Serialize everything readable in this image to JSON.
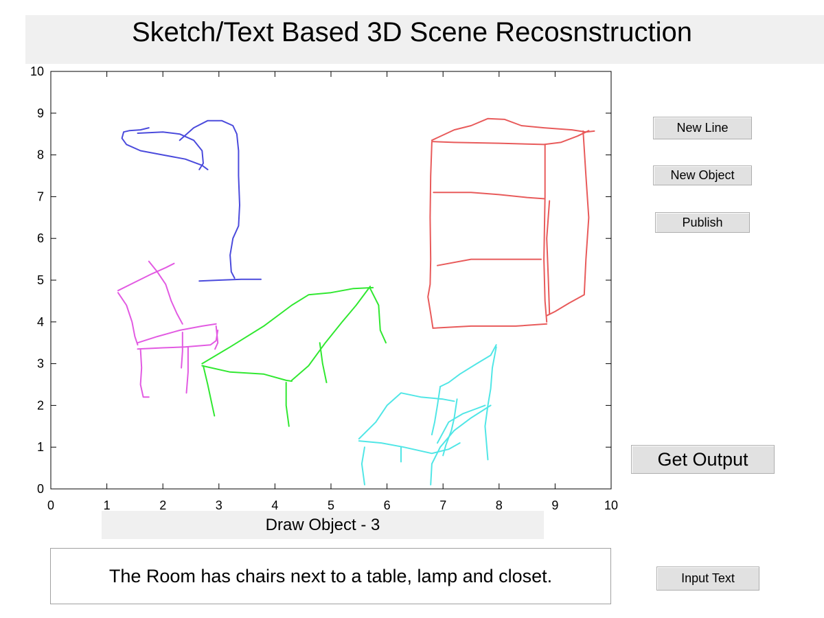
{
  "title": "Sketch/Text Based 3D Scene Recosnstruction",
  "buttons": {
    "new_line": "New Line",
    "new_object": "New Object",
    "publish": "Publish",
    "get_output": "Get Output",
    "input_text": "Input Text"
  },
  "status": "Draw Object - 3",
  "text_input": "The Room has chairs next to a table, lamp and closet.",
  "plot": {
    "xlim": [
      0,
      10
    ],
    "ylim": [
      0,
      10
    ],
    "xticks": [
      0,
      1,
      2,
      3,
      4,
      5,
      6,
      7,
      8,
      9,
      10
    ],
    "yticks": [
      0,
      1,
      2,
      3,
      4,
      5,
      6,
      7,
      8,
      9,
      10
    ],
    "sketches": [
      {
        "name": "lamp",
        "color": "#4a4adc",
        "strokes": [
          [
            [
              1.75,
              8.65
            ],
            [
              1.6,
              8.6
            ],
            [
              1.4,
              8.58
            ],
            [
              1.3,
              8.55
            ],
            [
              1.27,
              8.4
            ],
            [
              1.35,
              8.25
            ],
            [
              1.6,
              8.1
            ],
            [
              2.0,
              8.0
            ],
            [
              2.4,
              7.9
            ],
            [
              2.7,
              7.75
            ],
            [
              2.8,
              7.65
            ]
          ],
          [
            [
              1.55,
              8.52
            ],
            [
              2.0,
              8.55
            ],
            [
              2.3,
              8.5
            ],
            [
              2.55,
              8.35
            ],
            [
              2.7,
              8.1
            ],
            [
              2.72,
              7.8
            ],
            [
              2.65,
              7.65
            ]
          ],
          [
            [
              2.3,
              8.35
            ],
            [
              2.55,
              8.65
            ],
            [
              2.8,
              8.82
            ],
            [
              3.05,
              8.82
            ],
            [
              3.25,
              8.7
            ],
            [
              3.32,
              8.5
            ],
            [
              3.35,
              8.1
            ],
            [
              3.35,
              7.5
            ],
            [
              3.37,
              6.8
            ],
            [
              3.35,
              6.3
            ],
            [
              3.25,
              6.0
            ],
            [
              3.2,
              5.6
            ],
            [
              3.22,
              5.2
            ],
            [
              3.28,
              5.05
            ]
          ],
          [
            [
              2.65,
              4.98
            ],
            [
              3.0,
              5.0
            ],
            [
              3.4,
              5.02
            ],
            [
              3.75,
              5.02
            ]
          ]
        ]
      },
      {
        "name": "closet",
        "color": "#e85a5a",
        "strokes": [
          [
            [
              6.8,
              8.35
            ],
            [
              7.2,
              8.6
            ],
            [
              7.5,
              8.7
            ],
            [
              7.8,
              8.87
            ],
            [
              8.1,
              8.85
            ],
            [
              8.4,
              8.7
            ],
            [
              8.8,
              8.65
            ],
            [
              9.3,
              8.6
            ],
            [
              9.55,
              8.55
            ],
            [
              9.7,
              8.57
            ]
          ],
          [
            [
              6.8,
              8.32
            ],
            [
              7.2,
              8.3
            ],
            [
              8.0,
              8.28
            ],
            [
              8.8,
              8.25
            ],
            [
              9.1,
              8.3
            ],
            [
              9.4,
              8.45
            ],
            [
              9.6,
              8.58
            ]
          ],
          [
            [
              6.8,
              8.3
            ],
            [
              6.78,
              7.5
            ],
            [
              6.77,
              6.5
            ],
            [
              6.78,
              5.5
            ],
            [
              6.77,
              4.9
            ],
            [
              6.73,
              4.6
            ],
            [
              6.78,
              4.2
            ],
            [
              6.82,
              3.85
            ]
          ],
          [
            [
              6.82,
              3.85
            ],
            [
              7.5,
              3.9
            ],
            [
              8.3,
              3.9
            ],
            [
              8.85,
              3.95
            ]
          ],
          [
            [
              8.82,
              8.25
            ],
            [
              8.82,
              7.0
            ],
            [
              8.8,
              5.5
            ],
            [
              8.82,
              4.5
            ],
            [
              8.85,
              4.0
            ]
          ],
          [
            [
              6.83,
              7.1
            ],
            [
              7.5,
              7.1
            ],
            [
              8.0,
              7.05
            ],
            [
              8.5,
              6.98
            ],
            [
              8.8,
              6.95
            ]
          ],
          [
            [
              6.9,
              5.35
            ],
            [
              7.5,
              5.5
            ],
            [
              8.1,
              5.5
            ],
            [
              8.75,
              5.5
            ]
          ],
          [
            [
              9.5,
              8.57
            ],
            [
              9.55,
              7.5
            ],
            [
              9.6,
              6.5
            ],
            [
              9.55,
              5.5
            ],
            [
              9.52,
              4.65
            ],
            [
              9.25,
              4.45
            ],
            [
              9.0,
              4.25
            ],
            [
              8.85,
              4.15
            ]
          ],
          [
            [
              8.9,
              6.9
            ],
            [
              8.85,
              6.0
            ],
            [
              8.88,
              5.0
            ],
            [
              8.9,
              4.2
            ]
          ]
        ]
      },
      {
        "name": "chair-left",
        "color": "#e25ae2",
        "strokes": [
          [
            [
              1.75,
              5.45
            ],
            [
              1.9,
              5.2
            ],
            [
              2.05,
              4.9
            ],
            [
              2.15,
              4.5
            ],
            [
              2.25,
              4.2
            ],
            [
              2.35,
              3.95
            ]
          ],
          [
            [
              1.2,
              4.75
            ],
            [
              1.5,
              4.95
            ],
            [
              1.8,
              5.15
            ],
            [
              2.05,
              5.3
            ],
            [
              2.2,
              5.4
            ]
          ],
          [
            [
              1.2,
              4.7
            ],
            [
              1.35,
              4.4
            ],
            [
              1.45,
              4.0
            ],
            [
              1.5,
              3.65
            ],
            [
              1.55,
              3.45
            ]
          ],
          [
            [
              1.55,
              3.5
            ],
            [
              1.9,
              3.65
            ],
            [
              2.3,
              3.8
            ],
            [
              2.7,
              3.9
            ],
            [
              2.95,
              3.95
            ]
          ],
          [
            [
              1.55,
              3.35
            ],
            [
              2.0,
              3.38
            ],
            [
              2.4,
              3.4
            ],
            [
              2.85,
              3.45
            ],
            [
              2.95,
              3.55
            ],
            [
              2.98,
              3.8
            ]
          ],
          [
            [
              1.6,
              3.35
            ],
            [
              1.62,
              2.9
            ],
            [
              1.6,
              2.5
            ],
            [
              1.65,
              2.2
            ],
            [
              1.75,
              2.2
            ]
          ],
          [
            [
              2.35,
              3.75
            ],
            [
              2.35,
              3.3
            ],
            [
              2.33,
              2.9
            ]
          ],
          [
            [
              2.45,
              3.4
            ],
            [
              2.45,
              2.8
            ],
            [
              2.42,
              2.3
            ]
          ],
          [
            [
              2.95,
              3.9
            ],
            [
              2.98,
              3.5
            ],
            [
              2.93,
              3.35
            ]
          ]
        ]
      },
      {
        "name": "table",
        "color": "#30e830",
        "strokes": [
          [
            [
              2.7,
              3.0
            ],
            [
              3.2,
              3.4
            ],
            [
              3.8,
              3.9
            ],
            [
              4.3,
              4.4
            ],
            [
              4.6,
              4.65
            ],
            [
              5.0,
              4.7
            ],
            [
              5.4,
              4.8
            ],
            [
              5.75,
              4.82
            ]
          ],
          [
            [
              2.7,
              2.95
            ],
            [
              3.2,
              2.8
            ],
            [
              3.8,
              2.75
            ],
            [
              4.2,
              2.6
            ],
            [
              4.3,
              2.58
            ]
          ],
          [
            [
              4.3,
              2.6
            ],
            [
              4.6,
              2.95
            ],
            [
              4.9,
              3.5
            ],
            [
              5.2,
              4.0
            ],
            [
              5.45,
              4.4
            ],
            [
              5.7,
              4.85
            ]
          ],
          [
            [
              2.72,
              2.95
            ],
            [
              2.8,
              2.5
            ],
            [
              2.88,
              2.0
            ],
            [
              2.92,
              1.75
            ]
          ],
          [
            [
              4.2,
              2.55
            ],
            [
              4.2,
              2.0
            ],
            [
              4.25,
              1.5
            ]
          ],
          [
            [
              4.8,
              3.5
            ],
            [
              4.85,
              3.0
            ],
            [
              4.92,
              2.55
            ]
          ],
          [
            [
              5.7,
              4.8
            ],
            [
              5.85,
              4.4
            ],
            [
              5.88,
              3.8
            ],
            [
              5.98,
              3.5
            ]
          ]
        ]
      },
      {
        "name": "chair-right",
        "color": "#50e6e6",
        "strokes": [
          [
            [
              7.95,
              3.45
            ],
            [
              7.85,
              3.2
            ],
            [
              7.6,
              3.0
            ],
            [
              7.3,
              2.75
            ],
            [
              7.1,
              2.55
            ],
            [
              6.95,
              2.45
            ]
          ],
          [
            [
              6.95,
              2.45
            ],
            [
              6.9,
              2.0
            ],
            [
              6.85,
              1.6
            ],
            [
              6.8,
              1.3
            ]
          ],
          [
            [
              5.5,
              1.2
            ],
            [
              5.8,
              1.6
            ],
            [
              6.0,
              2.0
            ],
            [
              6.25,
              2.3
            ],
            [
              6.6,
              2.2
            ],
            [
              7.0,
              2.15
            ],
            [
              7.2,
              2.1
            ]
          ],
          [
            [
              5.5,
              1.15
            ],
            [
              5.9,
              1.1
            ],
            [
              6.3,
              1.0
            ],
            [
              6.8,
              0.85
            ],
            [
              7.1,
              0.95
            ],
            [
              7.3,
              1.1
            ]
          ],
          [
            [
              7.95,
              3.4
            ],
            [
              7.88,
              2.9
            ],
            [
              7.85,
              2.4
            ],
            [
              7.8,
              2.0
            ],
            [
              7.75,
              1.5
            ],
            [
              7.8,
              0.7
            ]
          ],
          [
            [
              7.25,
              2.15
            ],
            [
              7.2,
              1.7
            ],
            [
              7.15,
              1.4
            ],
            [
              7.05,
              1.05
            ],
            [
              7.0,
              0.8
            ]
          ],
          [
            [
              7.85,
              2.0
            ],
            [
              7.5,
              1.7
            ],
            [
              7.2,
              1.4
            ],
            [
              6.95,
              1.0
            ],
            [
              6.8,
              0.6
            ],
            [
              6.78,
              0.1
            ]
          ],
          [
            [
              7.75,
              2.0
            ],
            [
              7.55,
              1.9
            ],
            [
              7.35,
              1.8
            ],
            [
              7.1,
              1.6
            ],
            [
              6.9,
              1.1
            ]
          ],
          [
            [
              5.6,
              1.0
            ],
            [
              5.55,
              0.6
            ],
            [
              5.6,
              0.1
            ]
          ],
          [
            [
              6.25,
              1.0
            ],
            [
              6.25,
              0.65
            ]
          ]
        ]
      }
    ]
  }
}
